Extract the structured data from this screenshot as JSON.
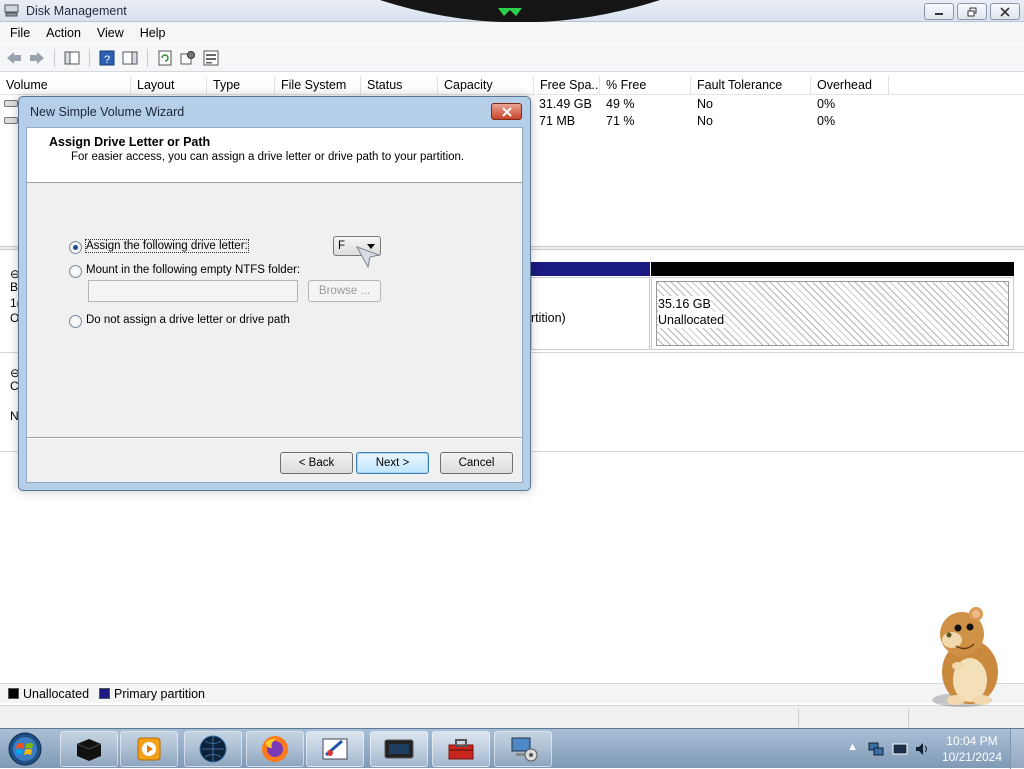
{
  "window": {
    "title": "Disk Management"
  },
  "menu": [
    "File",
    "Action",
    "View",
    "Help"
  ],
  "volume_list": {
    "columns": [
      "Volume",
      "Layout",
      "Type",
      "File System",
      "Status",
      "Capacity",
      "Free Spa...",
      "% Free",
      "Fault Tolerance",
      "Overhead"
    ],
    "rows": [
      {
        "free_space": "31.49 GB",
        "percent_free": "49 %",
        "fault_tolerance": "No",
        "overhead": "0%"
      },
      {
        "free_space": "71 MB",
        "percent_free": "71 %",
        "fault_tolerance": "No",
        "overhead": "0%"
      }
    ]
  },
  "disk_view": {
    "partition_label_partial": "artition)",
    "unallocated_size": "35.16 GB",
    "unallocated_label": "Unallocated",
    "left_fragments": [
      "B",
      "1(",
      "O",
      "C",
      "N"
    ]
  },
  "legend": {
    "items": [
      {
        "label": "Unallocated",
        "color": "#000000"
      },
      {
        "label": "Primary partition",
        "color": "#1a1a80"
      }
    ]
  },
  "dialog": {
    "title": "New Simple Volume Wizard",
    "heading": "Assign Drive Letter or Path",
    "subheading": "For easier access, you can assign a drive letter or drive path to your partition.",
    "option_assign_letter": "Assign the following drive letter:",
    "option_mount_folder": "Mount in the following empty NTFS folder:",
    "option_no_letter": "Do not assign a drive letter or drive path",
    "drive_letter_value": "F",
    "folder_path_value": "",
    "browse_label": "Browse ...",
    "back_label": "< Back",
    "next_label": "Next >",
    "cancel_label": "Cancel"
  },
  "taskbar": {
    "apps": [
      "terminal-icon",
      "media-player-icon",
      "globe-icon",
      "firefox-icon",
      "paint-icon",
      "display-icon",
      "toolbox-icon",
      "network-computer-icon"
    ],
    "clock_time": "10:04 PM",
    "clock_date": "10/21/2024"
  }
}
